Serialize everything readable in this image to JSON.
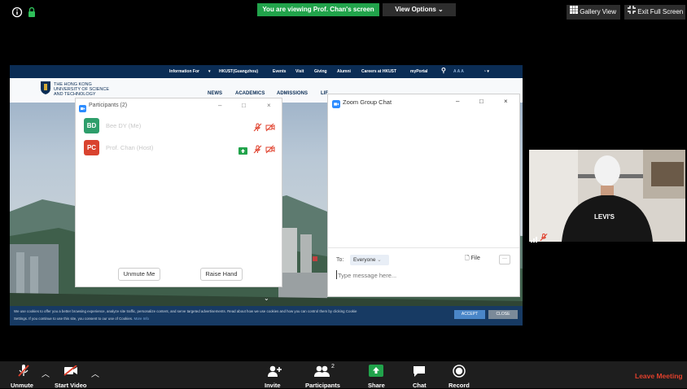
{
  "topbar": {
    "viewing_text": "You are viewing Prof. Chan's screen",
    "view_options_label": "View Options",
    "gallery_view_label": "Gallery View",
    "exit_full_screen_label": "Exit Full Screen"
  },
  "website": {
    "nav_items": [
      "Information For",
      "HKUST(Guangzhou)",
      "Events",
      "Visit",
      "Giving",
      "Alumni",
      "Careers at HKUST",
      "myPortal"
    ],
    "font_size_label": "A A A",
    "logo_text": [
      "THE HONG KONG",
      "UNIVERSITY OF SCIENCE",
      "AND TECHNOLOGY"
    ],
    "main_menu": [
      "NEWS",
      "ACADEMICS",
      "ADMISSIONS",
      "LIF"
    ],
    "cookie_text_line1": "We use cookies to offer you a better browsing experience, analyze site traffic, personalize content, and serve targeted advertisements. Read about how we use cookies and how you can control them by clicking Cookie",
    "cookie_text_line2": "Settings. If you continue to use this site, you consent to our use of Cookies.",
    "cookie_more_info": "More Info",
    "accept_label": "ACCEPT",
    "close_label": "CLOSE"
  },
  "participants_panel": {
    "title": "Participants (2)",
    "participants": [
      {
        "initials": "BD",
        "name": "Bee DY (Me)",
        "color": "#2e9e6b"
      },
      {
        "initials": "PC",
        "name": "Prof. Chan (Host)",
        "color": "#d9432f"
      }
    ],
    "unmute_me_label": "Unmute Me",
    "raise_hand_label": "Raise Hand"
  },
  "chat_panel": {
    "title": "Zoom Group Chat",
    "to_label": "To:",
    "recipient": "Everyone",
    "file_label": "File",
    "more_label": "···",
    "message_placeholder": "Type message here..."
  },
  "video_tile": {
    "shirt_text": "LEVI'S"
  },
  "toolbar": {
    "unmute_label": "Unmute",
    "start_video_label": "Start Video",
    "invite_label": "Invite",
    "participants_label": "Participants",
    "participants_count": "2",
    "share_label": "Share",
    "chat_label": "Chat",
    "record_label": "Record",
    "leave_meeting_label": "Leave Meeting"
  },
  "colors": {
    "share_green": "#21a34b",
    "leave_red": "#e0402c",
    "hkust_navy": "#0b2d55",
    "zoom_blue": "#2d8cff"
  }
}
